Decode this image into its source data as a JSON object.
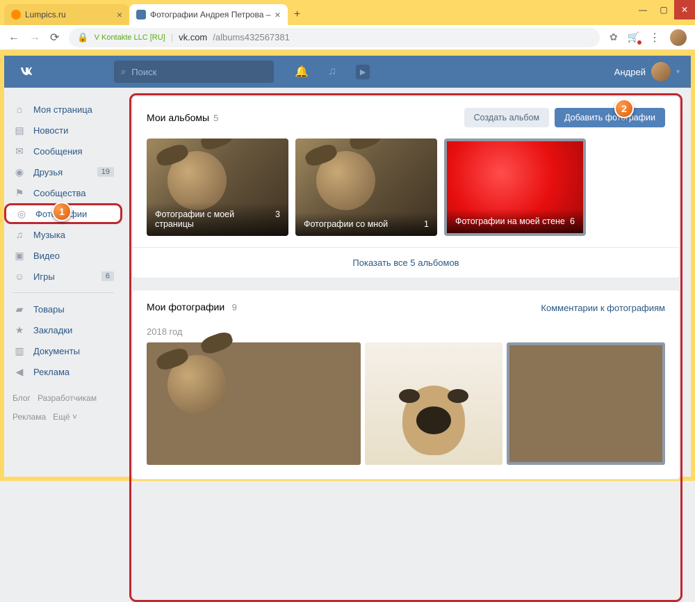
{
  "browser": {
    "tabs": [
      {
        "title": "Lumpics.ru",
        "active": false,
        "favicon": "orange"
      },
      {
        "title": "Фотографии Андрея Петрова –",
        "active": true,
        "favicon": "vk"
      }
    ],
    "address": {
      "secure_label": "V Kontakte LLC [RU]",
      "host": "vk.com",
      "path": "/albums432567381"
    },
    "window_controls": {
      "min": "—",
      "max": "▢",
      "close": "✕"
    }
  },
  "vk": {
    "search_placeholder": "Поиск",
    "user_name": "Андрей",
    "sidebar": {
      "items": [
        {
          "icon": "home",
          "label": "Моя страница",
          "badge": ""
        },
        {
          "icon": "news",
          "label": "Новости",
          "badge": ""
        },
        {
          "icon": "messages",
          "label": "Сообщения",
          "badge": ""
        },
        {
          "icon": "friends",
          "label": "Друзья",
          "badge": "19"
        },
        {
          "icon": "groups",
          "label": "Сообщества",
          "badge": ""
        },
        {
          "icon": "photos",
          "label": "Фотографии",
          "badge": "",
          "highlight": true
        },
        {
          "icon": "music",
          "label": "Музыка",
          "badge": ""
        },
        {
          "icon": "video",
          "label": "Видео",
          "badge": ""
        },
        {
          "icon": "games",
          "label": "Игры",
          "badge": "6"
        }
      ],
      "items2": [
        {
          "icon": "market",
          "label": "Товары"
        },
        {
          "icon": "bookmarks",
          "label": "Закладки"
        },
        {
          "icon": "docs",
          "label": "Документы"
        },
        {
          "icon": "ads",
          "label": "Реклама"
        }
      ],
      "footer": [
        "Блог",
        "Разработчикам",
        "Реклама",
        "Ещё ˅"
      ]
    },
    "albums": {
      "title": "Мои альбомы",
      "count": "5",
      "create_btn": "Создать альбом",
      "add_btn": "Добавить фотографии",
      "show_all": "Показать все 5 альбомов",
      "items": [
        {
          "name": "Фотографии с моей страницы",
          "count": "3",
          "style": "dog"
        },
        {
          "name": "Фотографии со мной",
          "count": "1",
          "style": "dog"
        },
        {
          "name": "Фотографии на моей стене",
          "count": "6",
          "style": "red"
        }
      ]
    },
    "photos": {
      "title": "Мои фотографии",
      "count": "9",
      "comments_link": "Комментарии к фотографиям",
      "year": "2018 год"
    }
  },
  "markers": [
    "1",
    "2"
  ],
  "icons": {
    "home": "⌂",
    "news": "▤",
    "messages": "✉",
    "friends": "◉",
    "groups": "⚑",
    "photos": "◎",
    "music": "♫",
    "video": "▣",
    "games": "☺",
    "market": "▰",
    "bookmarks": "★",
    "docs": "▥",
    "ads": "◀",
    "search": "⌕",
    "bell": "🔔",
    "note": "♫",
    "play": "▶"
  }
}
